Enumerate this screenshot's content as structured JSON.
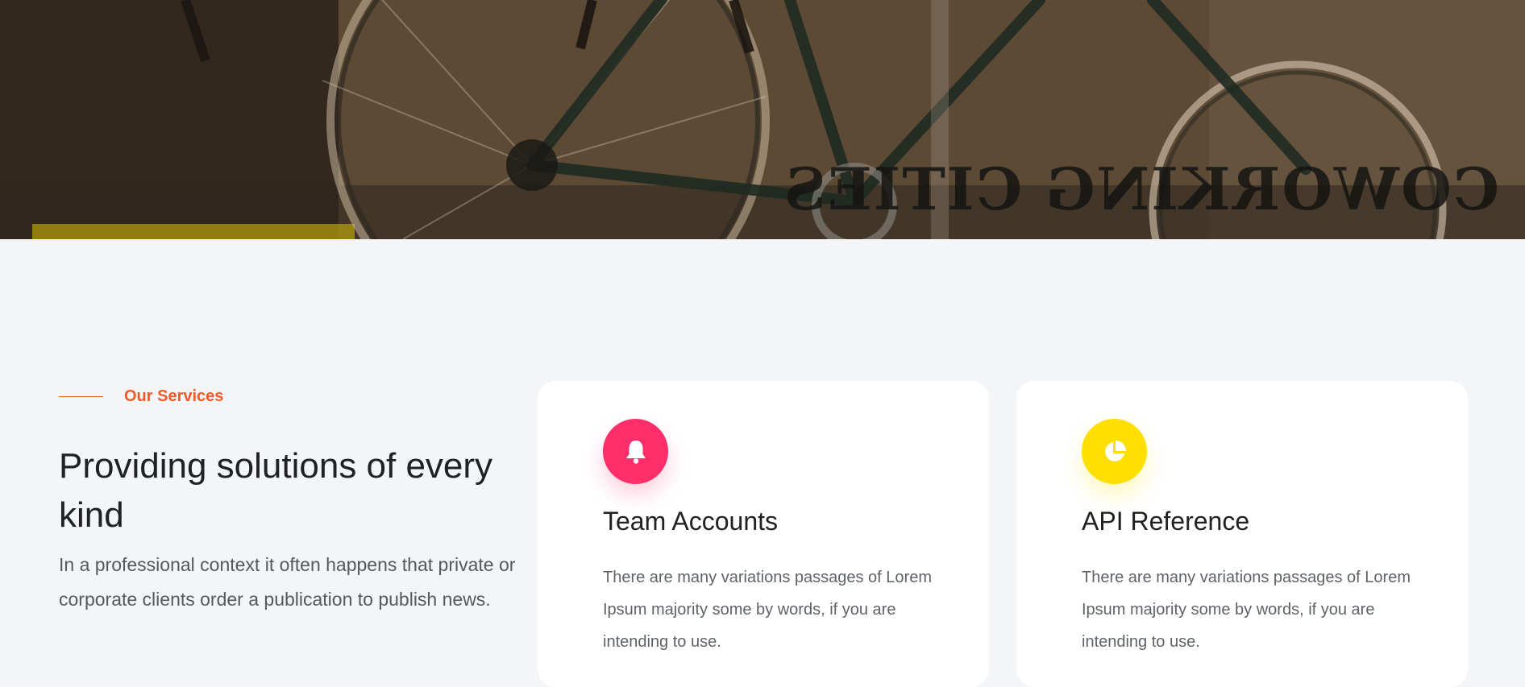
{
  "hero": {
    "sign_text": "COWORKING CITIES",
    "image_icon": "bicycles-photo"
  },
  "services": {
    "tag": "Our Services",
    "headline": "Providing solutions of every kind",
    "lead": "In a professional context it often happens that private or corporate clients order a publication to publish news.",
    "cards": [
      {
        "title": "Team Accounts",
        "text": "There are many variations passages of Lorem Ipsum majority some by words, if you are intending to use.",
        "icon": "bell-icon",
        "icon_color": "#fe2e6b"
      },
      {
        "title": "API Reference",
        "text": "There are many variations passages of Lorem Ipsum majority some by words, if you are intending to use.",
        "icon": "pie-chart-icon",
        "icon_color": "#ffdf00"
      }
    ]
  },
  "colors": {
    "accent": "#f05a28",
    "background": "#f4f5f7",
    "card": "#ffffff"
  }
}
